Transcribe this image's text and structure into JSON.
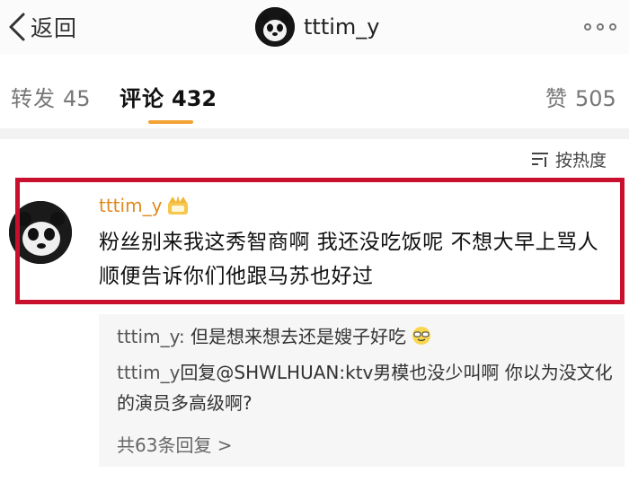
{
  "nav": {
    "back_label": "返回",
    "title": "tttim_y"
  },
  "tabs": [
    {
      "label": "转发",
      "count": "45"
    },
    {
      "label": "评论",
      "count": "432"
    },
    {
      "label": "赞",
      "count": "505"
    }
  ],
  "sort": {
    "label": "按热度"
  },
  "comment": {
    "username": "tttim_y",
    "text": "粉丝别来我这秀智商啊 我还没吃饭呢 不想大早上骂人 顺便告诉你们他跟马苏也好过"
  },
  "replies": [
    {
      "user": "tttim_y:",
      "text": " 但是想来想去还是嫂子好吃"
    },
    {
      "user": "tttim_y",
      "text": "回复@SHWLHUAN:ktv男模也没少叫啊 你以为没文化的演员多高级啊?"
    }
  ],
  "more_replies": "共63条回复 >",
  "colors": {
    "highlight": "#c8102e",
    "tab_accent": "#f3a234",
    "username": "#e08a1e"
  }
}
